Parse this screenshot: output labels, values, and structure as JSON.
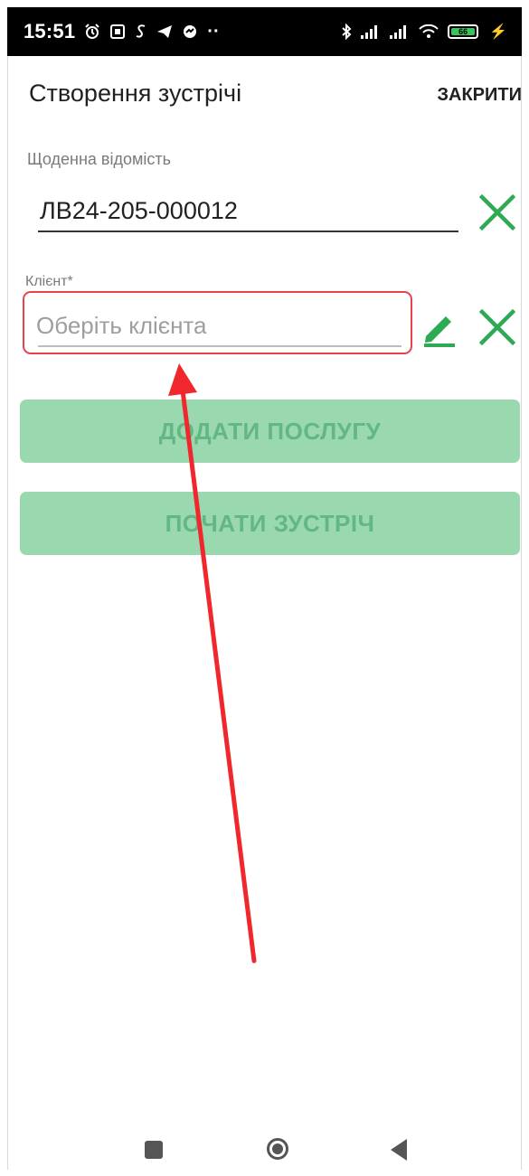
{
  "status_bar": {
    "time": "15:51",
    "left_icons": [
      "alarm-icon",
      "nfc-icon",
      "sim-icon",
      "telegram-icon",
      "messenger-icon"
    ],
    "overflow_dots": "··",
    "right_icons": [
      "bluetooth-icon",
      "signal-icon",
      "signal-icon",
      "wifi-icon"
    ],
    "battery_level": "66"
  },
  "header": {
    "title": "Створення зустрічі",
    "close_label": "ЗАКРИТИ"
  },
  "daily_sheet": {
    "label": "Щоденна відомість",
    "value": "ЛВ24-205-000012"
  },
  "client": {
    "label": "Клієнт*",
    "placeholder": "Оберіть клієнта"
  },
  "actions": {
    "add_service_label": "ДОДАТИ ПОСЛУГУ",
    "start_meeting_label": "ПОЧАТИ ЗУСТРІЧ"
  },
  "colors": {
    "accent_green": "#2eaa55",
    "disabled_button": "#9ad8b0",
    "disabled_button_text": "#62b784",
    "highlight_red": "#e8424a"
  }
}
